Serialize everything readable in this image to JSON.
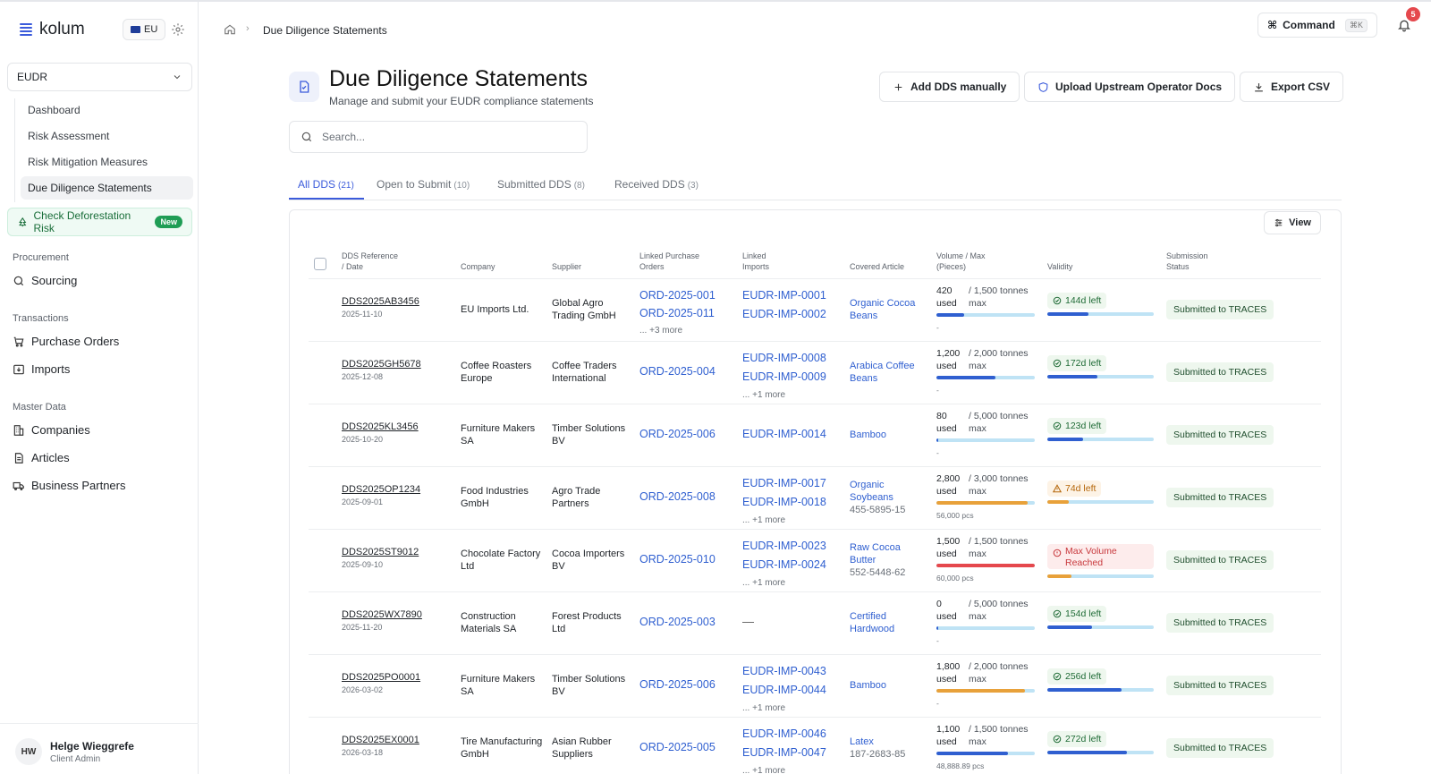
{
  "brand": {
    "name": "kolum",
    "region": "EU"
  },
  "sidebar": {
    "module": "EUDR",
    "subnav": [
      "Dashboard",
      "Risk Assessment",
      "Risk Mitigation Measures",
      "Due Diligence Statements"
    ],
    "check_risk": {
      "label": "Check Deforestation Risk",
      "badge": "New"
    },
    "sections": {
      "procurement": "Procurement",
      "transactions": "Transactions",
      "master_data": "Master Data"
    },
    "items": {
      "sourcing": "Sourcing",
      "purchase_orders": "Purchase Orders",
      "imports": "Imports",
      "companies": "Companies",
      "articles": "Articles",
      "business_partners": "Business Partners"
    },
    "user": {
      "initials": "HW",
      "name": "Helge Wieggrefe",
      "role": "Client Admin"
    }
  },
  "topbar": {
    "breadcrumb": "Due Diligence Statements",
    "command_label": "Command",
    "command_kbd": "⌘K",
    "notifications": "5"
  },
  "header": {
    "title": "Due Diligence Statements",
    "subtitle": "Manage and submit your EUDR compliance statements",
    "add_btn": "Add DDS manually",
    "upload_btn": "Upload Upstream Operator Docs",
    "export_btn": "Export CSV"
  },
  "search": {
    "placeholder": "Search..."
  },
  "tabs": [
    {
      "label": "All DDS",
      "count": "(21)"
    },
    {
      "label": "Open to Submit",
      "count": "(10)"
    },
    {
      "label": "Submitted DDS",
      "count": "(8)"
    },
    {
      "label": "Received DDS",
      "count": "(3)"
    }
  ],
  "table": {
    "view_btn": "View",
    "headers": {
      "ref1": "DDS Reference",
      "ref2": "/ Date",
      "company": "Company",
      "supplier": "Supplier",
      "po1": "Linked Purchase",
      "po2": "Orders",
      "imp1": "Linked",
      "imp2": "Imports",
      "article": "Covered Article",
      "vol1": "Volume / Max",
      "vol2": "(Pieces)",
      "validity": "Validity",
      "status1": "Submission",
      "status2": "Status"
    },
    "rows": [
      {
        "ref": "DDS2025AB3456",
        "date": "2025-11-10",
        "company1": "EU Imports Ltd.",
        "company2": "",
        "supplier1": "Global Agro",
        "supplier2": "Trading GmbH",
        "po": [
          "ORD-2025-001",
          "ORD-2025-011"
        ],
        "po_more": "... +3 more",
        "imp": [
          "EUDR-IMP-0001",
          "EUDR-IMP-0002"
        ],
        "imp_more": "",
        "article1": "Organic Cocoa",
        "article2": "Beans",
        "article_code": "",
        "vol": "420",
        "max": "/ 1,500 tonnes",
        "used": "used",
        "maxw": "max",
        "vol_frac": 0.28,
        "vol_color": "#2f5fd0",
        "pcs": "-",
        "validity": "144d left",
        "validity_kind": "ok",
        "validity_frac": 0.39,
        "validity_color": "#2f5fd0",
        "status": "Submitted to TRACES"
      },
      {
        "ref": "DDS2025GH5678",
        "date": "2025-12-08",
        "company1": "Coffee Roasters",
        "company2": "Europe",
        "supplier1": "Coffee Traders",
        "supplier2": "International",
        "po": [
          "ORD-2025-004"
        ],
        "po_more": "",
        "imp": [
          "EUDR-IMP-0008",
          "EUDR-IMP-0009"
        ],
        "imp_more": "... +1 more",
        "article1": "Arabica Coffee",
        "article2": "Beans",
        "article_code": "",
        "vol": "1,200",
        "max": "/ 2,000 tonnes",
        "used": "used",
        "maxw": "max",
        "vol_frac": 0.6,
        "vol_color": "#2f5fd0",
        "pcs": "-",
        "validity": "172d left",
        "validity_kind": "ok",
        "validity_frac": 0.47,
        "validity_color": "#2f5fd0",
        "status": "Submitted to TRACES"
      },
      {
        "ref": "DDS2025KL3456",
        "date": "2025-10-20",
        "company1": "Furniture Makers",
        "company2": "SA",
        "supplier1": "Timber Solutions",
        "supplier2": "BV",
        "po": [
          "ORD-2025-006"
        ],
        "po_more": "",
        "imp": [
          "EUDR-IMP-0014"
        ],
        "imp_more": "",
        "article1": "Bamboo",
        "article2": "",
        "article_code": "",
        "vol": "80",
        "max": "/ 5,000 tonnes",
        "used": "used",
        "maxw": "max",
        "vol_frac": 0.016,
        "vol_color": "#2f5fd0",
        "pcs": "-",
        "validity": "123d left",
        "validity_kind": "ok",
        "validity_frac": 0.34,
        "validity_color": "#2f5fd0",
        "status": "Submitted to TRACES"
      },
      {
        "ref": "DDS2025OP1234",
        "date": "2025-09-01",
        "company1": "Food Industries",
        "company2": "GmbH",
        "supplier1": "Agro Trade",
        "supplier2": "Partners",
        "po": [
          "ORD-2025-008"
        ],
        "po_more": "",
        "imp": [
          "EUDR-IMP-0017",
          "EUDR-IMP-0018"
        ],
        "imp_more": "... +1 more",
        "article1": "Organic",
        "article2": "Soybeans",
        "article_code": "455-5895-15",
        "vol": "2,800",
        "max": "/ 3,000 tonnes",
        "used": "used",
        "maxw": "max",
        "vol_frac": 0.93,
        "vol_color": "#e8a13a",
        "pcs": "56,000 pcs",
        "validity": "74d left",
        "validity_kind": "warn",
        "validity_frac": 0.2,
        "validity_color": "#e8a13a",
        "status": "Submitted to TRACES"
      },
      {
        "ref": "DDS2025ST9012",
        "date": "2025-09-10",
        "company1": "Chocolate Factory",
        "company2": "Ltd",
        "supplier1": "Cocoa Importers",
        "supplier2": "BV",
        "po": [
          "ORD-2025-010"
        ],
        "po_more": "",
        "imp": [
          "EUDR-IMP-0023",
          "EUDR-IMP-0024"
        ],
        "imp_more": "... +1 more",
        "article1": "Raw Cocoa",
        "article2": "Butter",
        "article_code": "552-5448-62",
        "vol": "1,500",
        "max": "/ 1,500 tonnes",
        "used": "used",
        "maxw": "max",
        "vol_frac": 1.0,
        "vol_color": "#e5484d",
        "pcs": "60,000 pcs",
        "validity": "Max Volume Reached",
        "validity_kind": "bad",
        "validity_frac": 0.23,
        "validity_color": "#e8a13a",
        "status": "Submitted to TRACES"
      },
      {
        "ref": "DDS2025WX7890",
        "date": "2025-11-20",
        "company1": "Construction",
        "company2": "Materials SA",
        "supplier1": "Forest Products",
        "supplier2": "Ltd",
        "po": [
          "ORD-2025-003"
        ],
        "po_more": "",
        "imp": [
          "—"
        ],
        "imp_more": "",
        "article1": "Certified",
        "article2": "Hardwood",
        "article_code": "",
        "vol": "0",
        "max": "/ 5,000 tonnes",
        "used": "used",
        "maxw": "max",
        "vol_frac": 0.0,
        "vol_color": "#2f5fd0",
        "pcs": "-",
        "validity": "154d left",
        "validity_kind": "ok",
        "validity_frac": 0.42,
        "validity_color": "#2f5fd0",
        "status": "Submitted to TRACES"
      },
      {
        "ref": "DDS2025PO0001",
        "date": "2026-03-02",
        "company1": "Furniture Makers",
        "company2": "SA",
        "supplier1": "Timber Solutions",
        "supplier2": "BV",
        "po": [
          "ORD-2025-006"
        ],
        "po_more": "",
        "imp": [
          "EUDR-IMP-0043",
          "EUDR-IMP-0044"
        ],
        "imp_more": "... +1 more",
        "article1": "Bamboo",
        "article2": "",
        "article_code": "",
        "vol": "1,800",
        "max": "/ 2,000 tonnes",
        "used": "used",
        "maxw": "max",
        "vol_frac": 0.9,
        "vol_color": "#e8a13a",
        "pcs": "-",
        "validity": "256d left",
        "validity_kind": "ok",
        "validity_frac": 0.7,
        "validity_color": "#2f5fd0",
        "status": "Submitted to TRACES"
      },
      {
        "ref": "DDS2025EX0001",
        "date": "2026-03-18",
        "company1": "Tire Manufacturing",
        "company2": "GmbH",
        "supplier1": "Asian Rubber",
        "supplier2": "Suppliers",
        "po": [
          "ORD-2025-005"
        ],
        "po_more": "",
        "imp": [
          "EUDR-IMP-0046",
          "EUDR-IMP-0047"
        ],
        "imp_more": "... +1 more",
        "article1": "Latex",
        "article2": "",
        "article_code": "187-2683-85",
        "vol": "1,100",
        "max": "/ 1,500 tonnes",
        "used": "used",
        "maxw": "max",
        "vol_frac": 0.73,
        "vol_color": "#2f5fd0",
        "pcs": "48,888.89 pcs",
        "validity": "272d left",
        "validity_kind": "ok",
        "validity_frac": 0.75,
        "validity_color": "#2f5fd0",
        "status": "Submitted to TRACES"
      }
    ]
  }
}
